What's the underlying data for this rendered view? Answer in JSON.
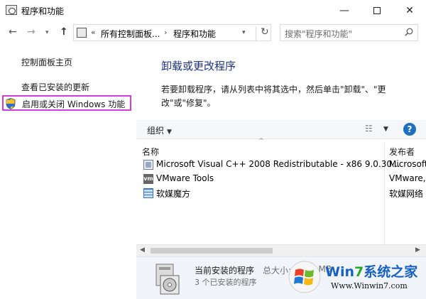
{
  "window": {
    "title": "程序和功能",
    "minimize": "—",
    "close": "✕"
  },
  "nav": {
    "back": "←",
    "forward": "→",
    "dropdown": "▾",
    "up": "↑"
  },
  "address": {
    "chevron": "«",
    "crumb1": "所有控制面板...",
    "separator": "›",
    "crumb2": "程序和功能",
    "dropdown": "▾",
    "refresh": "↻"
  },
  "search": {
    "placeholder": "搜索\"程序和功能\""
  },
  "sidebar": {
    "items": [
      {
        "label": "控制面板主页"
      },
      {
        "label": "查看已安装的更新"
      },
      {
        "label": "启用或关闭 Windows 功能"
      }
    ]
  },
  "main": {
    "heading": "卸载或更改程序",
    "description": "若要卸载程序，请从列表中将其选中，然后单击\"卸载\"、\"更改\"或\"修复\"。"
  },
  "toolbar": {
    "organize": "组织",
    "organize_arrow": "▼",
    "view": "☷",
    "view_arrow": "▼",
    "help": "?"
  },
  "table": {
    "sort_indicator": "^",
    "columns": {
      "name": "名称",
      "publisher": "发布者"
    },
    "rows": [
      {
        "name": "Microsoft Visual C++ 2008 Redistributable - x86 9.0.30...",
        "publisher": "Microsoft",
        "icon": "msi-package-icon"
      },
      {
        "name": "VMware Tools",
        "publisher": "VMware,",
        "icon": "vmware-icon"
      },
      {
        "name": "软媒魔方",
        "publisher": "软媒网络",
        "icon": "grid-app-icon"
      }
    ]
  },
  "scrollbar": {
    "left": "◀",
    "right": "▶"
  },
  "details": {
    "current_label": "当前安装的程序",
    "size_label": "总大小:",
    "size_value": "47.6 MB",
    "count_label": "3 个已安装的程序"
  },
  "watermark": {
    "title_prefix": "Win",
    "title_seven": "7",
    "title_suffix": "系统之家",
    "url": "Www.Winwin7.com"
  },
  "colors": {
    "heading": "#1e3287",
    "highlight_border": "#d23fd8",
    "help": "#1f6fbf",
    "watermark_blue": "#1660c3"
  }
}
